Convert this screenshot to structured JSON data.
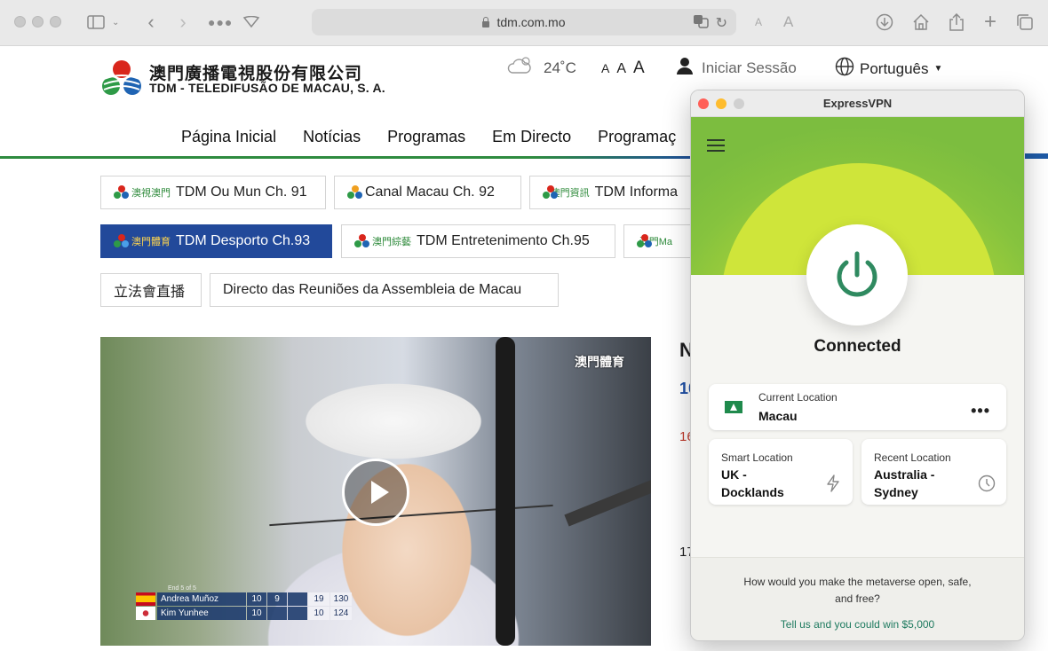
{
  "browser": {
    "url": "tdm.com.mo",
    "text_size_small": "A",
    "text_size_large": "A"
  },
  "header": {
    "brand_cn": "澳門廣播電視股份有限公司",
    "brand_pt": "TDM - TELEDIFUSÃO DE MACAU, S. A.",
    "temperature": "24˚C",
    "font_small": "A",
    "font_mid": "A",
    "font_large": "A",
    "login": "Iniciar Sessão",
    "language": "Português"
  },
  "nav": {
    "items": [
      "Página Inicial",
      "Notícias",
      "Programas",
      "Em Directo",
      "Programaç"
    ]
  },
  "channels": [
    {
      "cn": "澳視澳門",
      "label": "TDM Ou Mun Ch. 91"
    },
    {
      "cn": "",
      "label": "Canal Macau Ch. 92"
    },
    {
      "cn": "澳門資訊",
      "label": "TDM Informa"
    },
    {
      "cn": "澳門體育",
      "label": "TDM Desporto Ch.93"
    },
    {
      "cn": "澳門綜藝",
      "label": "TDM Entretenimento Ch.95"
    },
    {
      "cn": "澳門Ma",
      "label": ""
    },
    {
      "cn": "",
      "label": "立法會直播"
    },
    {
      "cn": "",
      "label": "Directo das Reuniões da Assembleia de Macau"
    }
  ],
  "video": {
    "watermark": "澳門體育",
    "score_header": "End 5 of 5",
    "score_total_label": "Total",
    "rows": [
      {
        "name": "Andrea Muñoz",
        "a": "10",
        "b": "9",
        "c": "",
        "set": "19",
        "total": "130"
      },
      {
        "name": "Kim Yunhee",
        "a": "10",
        "b": "",
        "c": "",
        "set": "10",
        "total": "124"
      }
    ]
  },
  "peek": {
    "n": "N",
    "d1": "10",
    "d2": "16",
    "d3": "17"
  },
  "vpn": {
    "title": "ExpressVPN",
    "status": "Connected",
    "current_label": "Current Location",
    "current_value": "Macau",
    "smart_label": "Smart Location",
    "smart_value_1": "UK -",
    "smart_value_2": "Docklands",
    "recent_label": "Recent Location",
    "recent_value_1": "Australia -",
    "recent_value_2": "Sydney",
    "question": "How would you make the metaverse open, safe, and free?",
    "cta": "Tell us and you could win $5,000",
    "colors": {
      "brand_green": "#2e8b5a",
      "hero": "#c7e03a"
    }
  }
}
